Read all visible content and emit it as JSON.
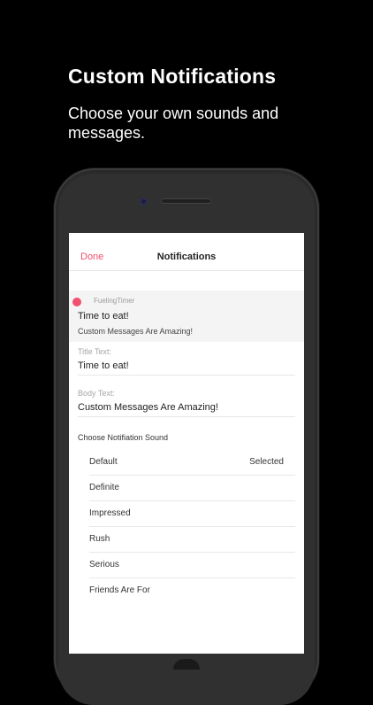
{
  "promo": {
    "headline": "Custom Notifications",
    "subline": "Choose your own sounds and messages."
  },
  "nav": {
    "done_label": "Done",
    "title": "Notifications"
  },
  "preview": {
    "app_name": "FuelingTimer",
    "title": "Time to eat!",
    "body": "Custom Messages Are Amazing!",
    "icon_color": "#f0506e"
  },
  "fields": {
    "title_label": "Title Text:",
    "title_value": "Time to eat!",
    "body_label": "Body Text:",
    "body_value": "Custom Messages Are Amazing!"
  },
  "sounds": {
    "heading": "Choose Notifiation Sound",
    "items": [
      {
        "name": "Default",
        "status": "Selected"
      },
      {
        "name": "Definite",
        "status": ""
      },
      {
        "name": "Impressed",
        "status": ""
      },
      {
        "name": "Rush",
        "status": ""
      },
      {
        "name": "Serious",
        "status": ""
      },
      {
        "name": "Friends Are For",
        "status": ""
      }
    ]
  },
  "colors": {
    "accent": "#f0506e",
    "background": "#000000"
  }
}
